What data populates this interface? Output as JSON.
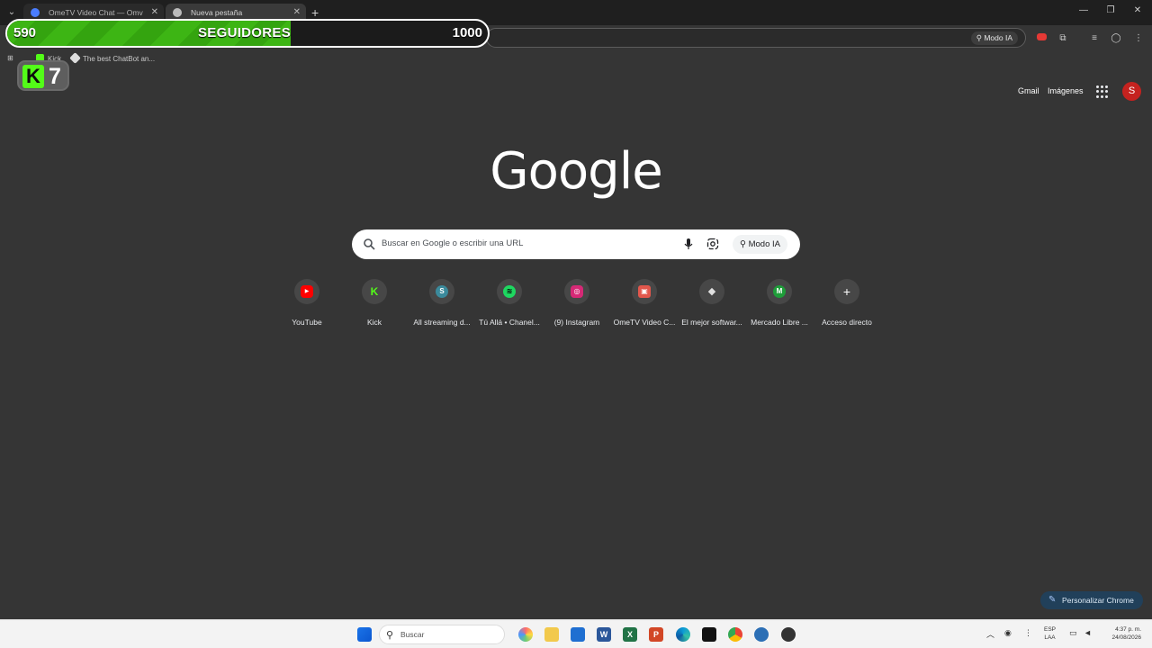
{
  "browser": {
    "tabs": [
      {
        "title": "OmeTV Video Chat — Omv",
        "favicon_color": "#4a7dff"
      },
      {
        "title": "Nueva pestaña",
        "favicon_color": "#bbbbbb"
      }
    ],
    "omnibox_ai_label": "Modo IA"
  },
  "overlay": {
    "current_followers": "590",
    "title": "SEGUIDORES",
    "goal": "1000",
    "progress": 0.59,
    "kick_count": "7"
  },
  "bookmarks": [
    {
      "label": "Kick",
      "color": "#53fc18"
    },
    {
      "label": "The best ChatBot an...",
      "color": "#dddddd"
    }
  ],
  "ntp": {
    "gmail_link": "Gmail",
    "images_link": "Imágenes",
    "avatar_letter": "S",
    "logo": "Google",
    "search_placeholder": "Buscar en Google o escribir una URL",
    "search_ai_label": "Modo IA",
    "shortcuts": [
      {
        "label": "YouTube",
        "icon": "youtube-icon",
        "color": "#ff0000",
        "glyph": "▶"
      },
      {
        "label": "Kick",
        "icon": "kick-icon",
        "color": "#53fc18",
        "glyph": "K"
      },
      {
        "label": "All streaming d...",
        "icon": "streaming-icon",
        "color": "#3b8a9c",
        "glyph": "S"
      },
      {
        "label": "Tú Allá • Chanel...",
        "icon": "spotify-icon",
        "color": "#1ed760",
        "glyph": "≋"
      },
      {
        "label": "(9) Instagram",
        "icon": "instagram-icon",
        "color": "#d62976",
        "glyph": "◎"
      },
      {
        "label": "OmeTV Video C...",
        "icon": "ometv-icon",
        "color": "#e2574c",
        "glyph": "▣"
      },
      {
        "label": "El mejor softwar...",
        "icon": "streamerbot-icon",
        "color": "#e0e0e0",
        "glyph": "◆"
      },
      {
        "label": "Mercado Libre ...",
        "icon": "mercadolibre-icon",
        "color": "#1f9d3a",
        "glyph": "M"
      },
      {
        "label": "Acceso directo",
        "icon": "add-icon",
        "color": "#474747",
        "glyph": "+"
      }
    ],
    "customize_label": "Personalizar Chrome"
  },
  "taskbar": {
    "search_placeholder": "Buscar",
    "lang_line1": "ESP",
    "lang_line2": "LAA",
    "time": "4:37 p. m.",
    "date": "24/08/2026"
  }
}
